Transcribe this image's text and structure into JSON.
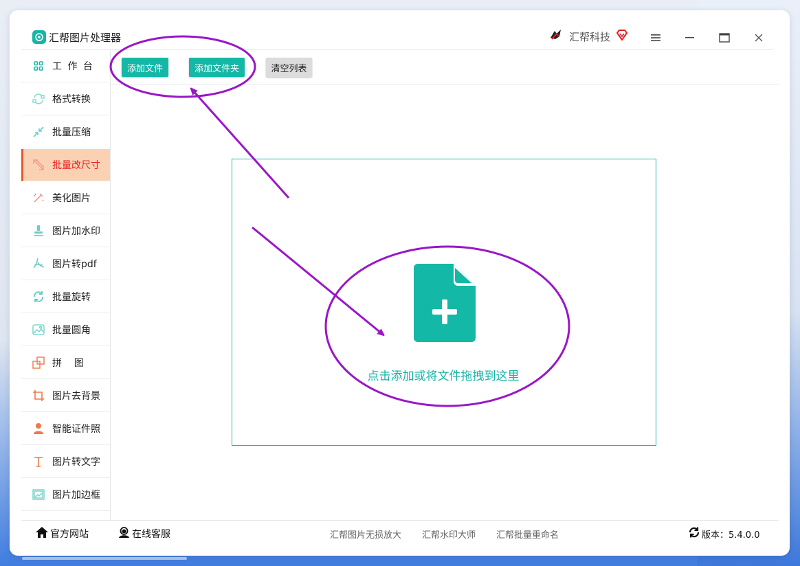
{
  "app": {
    "title": "汇帮图片处理器",
    "brand": "汇帮科技",
    "accent": "#14b8a6",
    "active_bg": "#fbd1b4",
    "active_text": "#e82222"
  },
  "window_controls": {
    "menu_icon": "menu-icon",
    "minimize_icon": "minimize-icon",
    "maximize_icon": "maximize-icon",
    "close_icon": "close-icon"
  },
  "sidebar": {
    "items": [
      {
        "label": "工 作 台",
        "icon": "grid-icon"
      },
      {
        "label": "格式转换",
        "icon": "convert-icon"
      },
      {
        "label": "批量压缩",
        "icon": "compress-icon"
      },
      {
        "label": "批量改尺寸",
        "icon": "resize-icon",
        "active": true
      },
      {
        "label": "美化图片",
        "icon": "beautify-icon"
      },
      {
        "label": "图片加水印",
        "icon": "watermark-icon"
      },
      {
        "label": "图片转pdf",
        "icon": "pdf-icon"
      },
      {
        "label": "批量旋转",
        "icon": "rotate-icon"
      },
      {
        "label": "批量圆角",
        "icon": "rounded-corner-icon"
      },
      {
        "label": "拼    图",
        "icon": "collage-icon"
      },
      {
        "label": "图片去背景",
        "icon": "crop-icon"
      },
      {
        "label": "智能证件照",
        "icon": "person-icon"
      },
      {
        "label": "图片转文字",
        "icon": "text-icon"
      },
      {
        "label": "图片加边框",
        "icon": "frame-icon"
      }
    ]
  },
  "toolbar": {
    "add_file": "添加文件",
    "add_folder": "添加文件夹",
    "clear_list": "清空列表"
  },
  "dropzone": {
    "text": "点击添加或将文件拖拽到这里",
    "icon": "add-file-icon"
  },
  "footer": {
    "website": "官方网站",
    "support": "在线客服",
    "links": [
      "汇帮图片无损放大",
      "汇帮水印大师",
      "汇帮批量重命名"
    ],
    "version_label": "版本：5.4.0.0"
  },
  "annotations": {
    "color": "#9a16c8"
  }
}
